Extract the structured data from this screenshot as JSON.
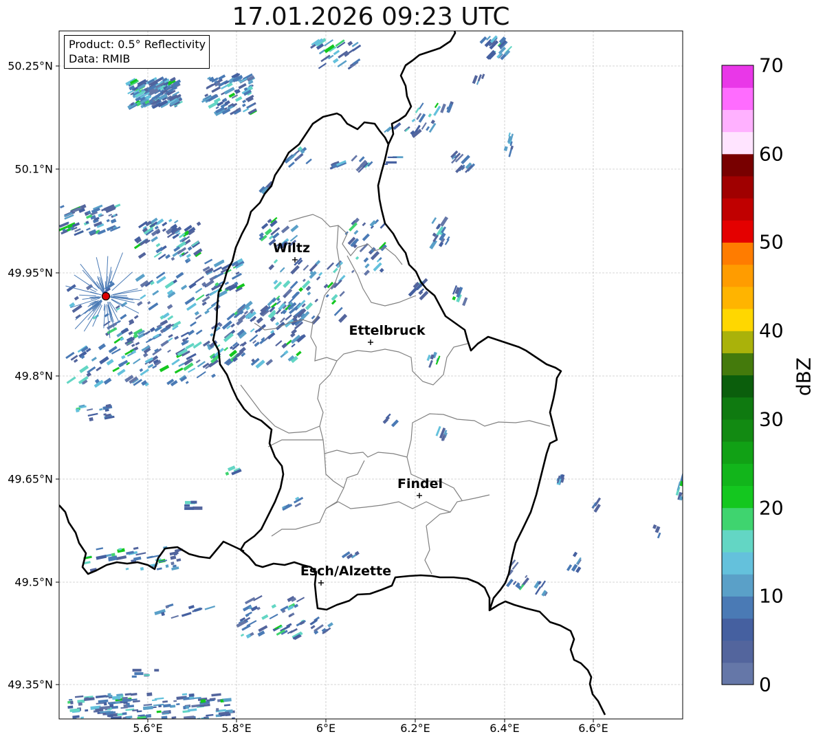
{
  "title": "17.01.2026 09:23 UTC",
  "info": {
    "product": "Product: 0.5° Reflectivity",
    "data": "Data: RMIB"
  },
  "axes": {
    "lat_ticks": [
      "50.25°N",
      "50.1°N",
      "49.95°N",
      "49.8°N",
      "49.65°N",
      "49.5°N",
      "49.35°N"
    ],
    "lon_ticks": [
      "5.6°E",
      "5.8°E",
      "6°E",
      "6.2°E",
      "6.4°E",
      "6.6°E"
    ]
  },
  "cities": [
    {
      "name": "Wiltz"
    },
    {
      "name": "Ettelbruck"
    },
    {
      "name": "Findel"
    },
    {
      "name": "Esch/Alzette"
    }
  ],
  "colorbar": {
    "label": "dBZ",
    "ticks": [
      "0",
      "10",
      "20",
      "30",
      "40",
      "50",
      "60",
      "70"
    ],
    "colors": [
      "#6577a8",
      "#53659d",
      "#4560a0",
      "#4a7ab5",
      "#5aa0c8",
      "#64c1dc",
      "#63d6c4",
      "#3fd46f",
      "#14c71f",
      "#12b51b",
      "#11a115",
      "#128a12",
      "#0f7a10",
      "#0b5e0c",
      "#447a0c",
      "#aab20a",
      "#ffd700",
      "#ffb400",
      "#ff9c00",
      "#ff7c00",
      "#e40000",
      "#c00000",
      "#a00000",
      "#780000",
      "#ffe4ff",
      "#ffb1ff",
      "#ff6cff",
      "#e937e8"
    ]
  },
  "colors": {
    "radar_site": "#dd0000",
    "border": "#000000",
    "canton_lines": "#808080",
    "grid": "#c8c8c8"
  }
}
